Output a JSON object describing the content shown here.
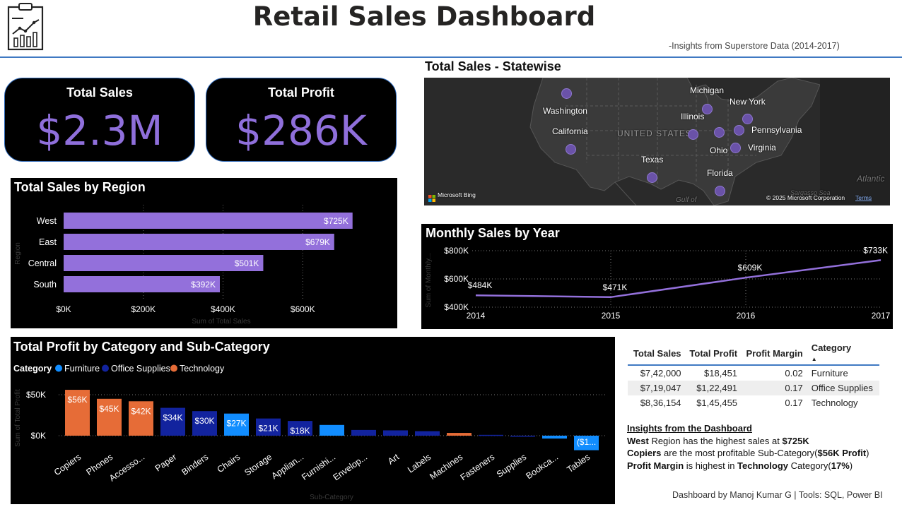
{
  "header": {
    "title": "Retail Sales Dashboard",
    "subtitle": "-Insights from Superstore Data (2014-2017)",
    "logo_icon": "report-chart-clipboard-icon"
  },
  "kpis": [
    {
      "label": "Total Sales",
      "value": "$2.3M"
    },
    {
      "label": "Total Profit",
      "value": "$286K"
    }
  ],
  "colors": {
    "purple": "#9370db",
    "furniture": "#118dff",
    "office_supplies": "#12239e",
    "technology": "#e66c37",
    "kpi_value": "#8f6fdb",
    "header_line": "#3f79c2"
  },
  "region_chart": {
    "title": "Total Sales by Region",
    "chart_data": {
      "type": "bar",
      "orientation": "horizontal",
      "categories": [
        "West",
        "East",
        "Central",
        "South"
      ],
      "values": [
        725,
        679,
        501,
        392
      ],
      "data_labels": [
        "$725K",
        "$679K",
        "$501K",
        "$392K"
      ],
      "xlabel": "Sum of Total Sales",
      "ylabel": "Region",
      "xlim": [
        0,
        800
      ],
      "x_ticks": [
        0,
        200,
        400,
        600
      ],
      "x_tick_labels": [
        "$0K",
        "$200K",
        "$400K",
        "$600K"
      ],
      "grid": true
    }
  },
  "map": {
    "title": "Total Sales - Statewise",
    "country_label": "UNITED STATES",
    "ocean_label": "Atlantic",
    "gulf_label": "Gulf of",
    "sea_label": "Sargasso Sea",
    "brand": "Microsoft Bing",
    "copyright": "© 2025 Microsoft Corporation",
    "terms": "Terms",
    "states": [
      "Washington",
      "California",
      "Texas",
      "Illinois",
      "Michigan",
      "New York",
      "Pennsylvania",
      "Ohio",
      "Virginia",
      "Florida"
    ]
  },
  "monthly_chart": {
    "title": "Monthly Sales by Year",
    "chart_data": {
      "type": "line",
      "x": [
        "2014",
        "2015",
        "2016",
        "2017"
      ],
      "values": [
        484,
        471,
        609,
        733
      ],
      "data_labels": [
        "$484K",
        "$471K",
        "$609K",
        "$733K"
      ],
      "ylabel": "Sum of Monthly...",
      "ylim": [
        400,
        800
      ],
      "y_ticks": [
        400,
        600,
        800
      ],
      "y_tick_labels": [
        "$400K",
        "$600K",
        "$800K"
      ],
      "grid": true
    }
  },
  "category_chart": {
    "title": "Total Profit by Category and Sub-Category",
    "legend_title": "Category",
    "chart_data": {
      "type": "bar",
      "categories": [
        "Copiers",
        "Phones",
        "Accesso...",
        "Paper",
        "Binders",
        "Chairs",
        "Storage",
        "Applian...",
        "Furnishi...",
        "Envelop...",
        "Art",
        "Labels",
        "Machines",
        "Fasteners",
        "Supplies",
        "Bookca...",
        "Tables"
      ],
      "series": [
        {
          "name": "Furniture",
          "color": "#118dff"
        },
        {
          "name": "Office Supplies",
          "color": "#12239e"
        },
        {
          "name": "Technology",
          "color": "#e66c37"
        }
      ],
      "bar_series": [
        "Technology",
        "Technology",
        "Technology",
        "Office Supplies",
        "Office Supplies",
        "Furniture",
        "Office Supplies",
        "Office Supplies",
        "Furniture",
        "Office Supplies",
        "Office Supplies",
        "Office Supplies",
        "Technology",
        "Office Supplies",
        "Office Supplies",
        "Furniture",
        "Furniture"
      ],
      "values": [
        56,
        45,
        42,
        34,
        30,
        27,
        21,
        18,
        13.1,
        7,
        6.5,
        5.5,
        3.4,
        1,
        -1.2,
        -3.5,
        -17.7
      ],
      "data_labels": [
        "$56K",
        "$45K",
        "$42K",
        "$34K",
        "$30K",
        "$27K",
        "$21K",
        "$18K",
        "",
        "",
        "",
        "",
        "",
        "",
        "",
        "",
        "($1..."
      ],
      "xlabel": "Sub-Category",
      "ylabel": "Sum of Total Profit",
      "ylim": [
        -20,
        60
      ],
      "y_ticks": [
        0,
        50
      ],
      "y_tick_labels": [
        "$0K",
        "$50K"
      ],
      "legend": "top-left"
    }
  },
  "summary_table": {
    "columns": [
      "Total Sales",
      "Total Profit",
      "Profit Margin",
      "Category"
    ],
    "sort_indicator": "▲",
    "rows": [
      [
        "$7,42,000",
        "$18,451",
        "0.02",
        "Furniture"
      ],
      [
        "$7,19,047",
        "$1,22,491",
        "0.17",
        "Office Supplies"
      ],
      [
        "$8,36,154",
        "$1,45,455",
        "0.17",
        "Technology"
      ]
    ]
  },
  "insights": {
    "title": "Insights from the Dashboard",
    "lines": [
      [
        {
          "t": "West",
          "b": true
        },
        {
          "t": " Region has the highest sales at ",
          "b": false
        },
        {
          "t": "$725K",
          "b": true
        }
      ],
      [
        {
          "t": "Copiers",
          "b": true
        },
        {
          "t": " are the most profitable Sub-Category(",
          "b": false
        },
        {
          "t": "$56K Profit",
          "b": true
        },
        {
          "t": ")",
          "b": false
        }
      ],
      [
        {
          "t": "Profit Margin",
          "b": true
        },
        {
          "t": " is highest in ",
          "b": false
        },
        {
          "t": "Technology",
          "b": true
        },
        {
          "t": " Category(",
          "b": false
        },
        {
          "t": "17%",
          "b": true
        },
        {
          "t": ")",
          "b": false
        }
      ]
    ]
  },
  "footer": "Dashboard by Manoj Kumar G | Tools: SQL, Power BI"
}
